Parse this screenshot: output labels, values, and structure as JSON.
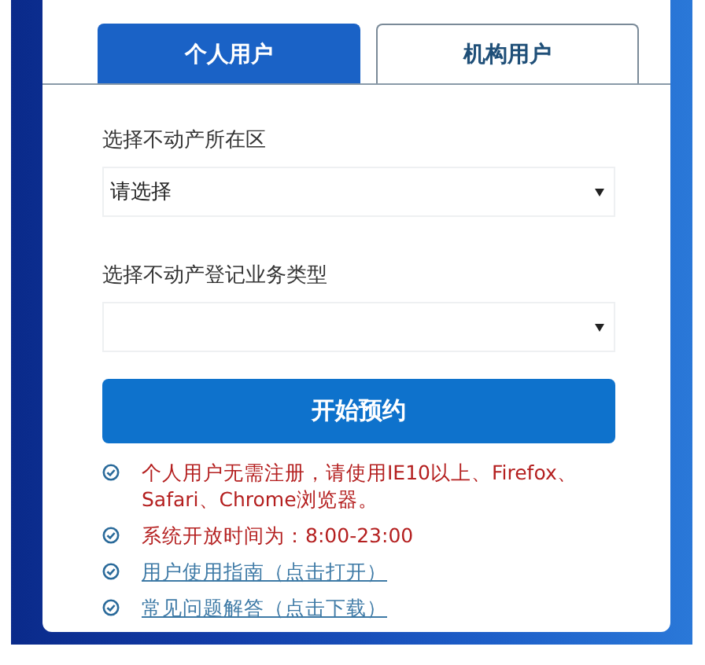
{
  "tabs": [
    {
      "label": "个人用户",
      "selected": true
    },
    {
      "label": "机构用户",
      "selected": false
    }
  ],
  "fields": [
    {
      "label": "选择不动产所在区",
      "value": "请选择"
    },
    {
      "label": "选择不动产登记业务类型"
    }
  ],
  "submit_button": "开始预约",
  "notes": [
    {
      "kind": "text",
      "text": "个人用户无需注册，请使用IE10以上、Firefox、Safari、Chrome浏览器。"
    },
    {
      "kind": "text",
      "text": "系统开放时间为：8:00-23:00"
    },
    {
      "kind": "link",
      "text": "用户使用指南（点击打开）"
    },
    {
      "kind": "link",
      "text": "常见问题解答（点击下载）"
    }
  ]
}
